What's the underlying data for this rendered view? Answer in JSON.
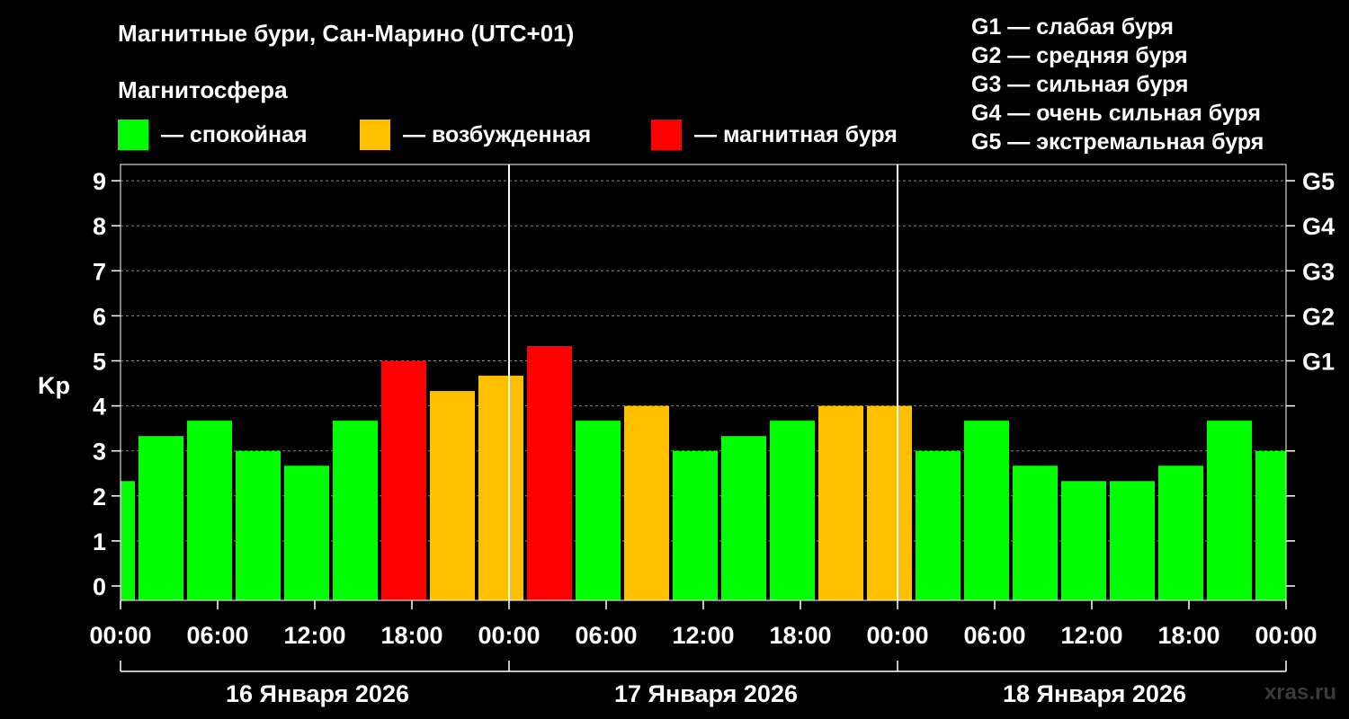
{
  "title": "Магнитные бури, Сан-Марино (UTC+01)",
  "subtitle": "Магнитосфера",
  "legend": [
    {
      "label": "— спокойная",
      "color": "#00ff00"
    },
    {
      "label": "— возбужденная",
      "color": "#ffc000"
    },
    {
      "label": "— магнитная буря",
      "color": "#ff0000"
    }
  ],
  "gscale": [
    "G1 — слабая буря",
    "G2 — средняя буря",
    "G3 — сильная буря",
    "G4 — очень сильная буря",
    "G5 — экстремальная буря"
  ],
  "watermark": "xras.ru",
  "chart_data": {
    "type": "bar",
    "ylabel": "Kp",
    "ylim": [
      0,
      9
    ],
    "yticks": [
      0,
      1,
      2,
      3,
      4,
      5,
      6,
      7,
      8,
      9
    ],
    "right_ticks": [
      {
        "value": 5,
        "label": "G1"
      },
      {
        "value": 6,
        "label": "G2"
      },
      {
        "value": 7,
        "label": "G3"
      },
      {
        "value": 8,
        "label": "G4"
      },
      {
        "value": 9,
        "label": "G5"
      }
    ],
    "xlim_hours": [
      0,
      72
    ],
    "xticks": [
      {
        "hour": 0,
        "label": "00:00"
      },
      {
        "hour": 6,
        "label": "06:00"
      },
      {
        "hour": 12,
        "label": "12:00"
      },
      {
        "hour": 18,
        "label": "18:00"
      },
      {
        "hour": 24,
        "label": "00:00"
      },
      {
        "hour": 30,
        "label": "06:00"
      },
      {
        "hour": 36,
        "label": "12:00"
      },
      {
        "hour": 42,
        "label": "18:00"
      },
      {
        "hour": 48,
        "label": "00:00"
      },
      {
        "hour": 54,
        "label": "06:00"
      },
      {
        "hour": 60,
        "label": "12:00"
      },
      {
        "hour": 66,
        "label": "18:00"
      },
      {
        "hour": 72,
        "label": "00:00"
      }
    ],
    "days": [
      "16 Января 2026",
      "17 Января 2026",
      "18 Января 2026"
    ],
    "day_separators_hours": [
      24,
      48
    ],
    "grid": "dashed horizontal",
    "bars": [
      {
        "start": -2,
        "end": 1,
        "value": 2.33,
        "level": "quiet"
      },
      {
        "start": 1,
        "end": 4,
        "value": 3.33,
        "level": "quiet"
      },
      {
        "start": 4,
        "end": 7,
        "value": 3.67,
        "level": "quiet"
      },
      {
        "start": 7,
        "end": 10,
        "value": 3.0,
        "level": "quiet"
      },
      {
        "start": 10,
        "end": 13,
        "value": 2.67,
        "level": "quiet"
      },
      {
        "start": 13,
        "end": 16,
        "value": 3.67,
        "level": "quiet"
      },
      {
        "start": 16,
        "end": 19,
        "value": 5.0,
        "level": "storm"
      },
      {
        "start": 19,
        "end": 22,
        "value": 4.33,
        "level": "active"
      },
      {
        "start": 22,
        "end": 25,
        "value": 4.67,
        "level": "active"
      },
      {
        "start": 25,
        "end": 28,
        "value": 5.33,
        "level": "storm"
      },
      {
        "start": 28,
        "end": 31,
        "value": 3.67,
        "level": "quiet"
      },
      {
        "start": 31,
        "end": 34,
        "value": 4.0,
        "level": "active"
      },
      {
        "start": 34,
        "end": 37,
        "value": 3.0,
        "level": "quiet"
      },
      {
        "start": 37,
        "end": 40,
        "value": 3.33,
        "level": "quiet"
      },
      {
        "start": 40,
        "end": 43,
        "value": 3.67,
        "level": "quiet"
      },
      {
        "start": 43,
        "end": 46,
        "value": 4.0,
        "level": "active"
      },
      {
        "start": 46,
        "end": 49,
        "value": 4.0,
        "level": "active"
      },
      {
        "start": 49,
        "end": 52,
        "value": 3.0,
        "level": "quiet"
      },
      {
        "start": 52,
        "end": 55,
        "value": 3.67,
        "level": "quiet"
      },
      {
        "start": 55,
        "end": 58,
        "value": 2.67,
        "level": "quiet"
      },
      {
        "start": 58,
        "end": 61,
        "value": 2.33,
        "level": "quiet"
      },
      {
        "start": 61,
        "end": 64,
        "value": 2.33,
        "level": "quiet"
      },
      {
        "start": 64,
        "end": 67,
        "value": 2.67,
        "level": "quiet"
      },
      {
        "start": 67,
        "end": 70,
        "value": 3.67,
        "level": "quiet"
      },
      {
        "start": 70,
        "end": 73,
        "value": 3.0,
        "level": "quiet"
      }
    ],
    "level_colors": {
      "quiet": "#00ff00",
      "active": "#ffc000",
      "storm": "#ff0000"
    }
  }
}
